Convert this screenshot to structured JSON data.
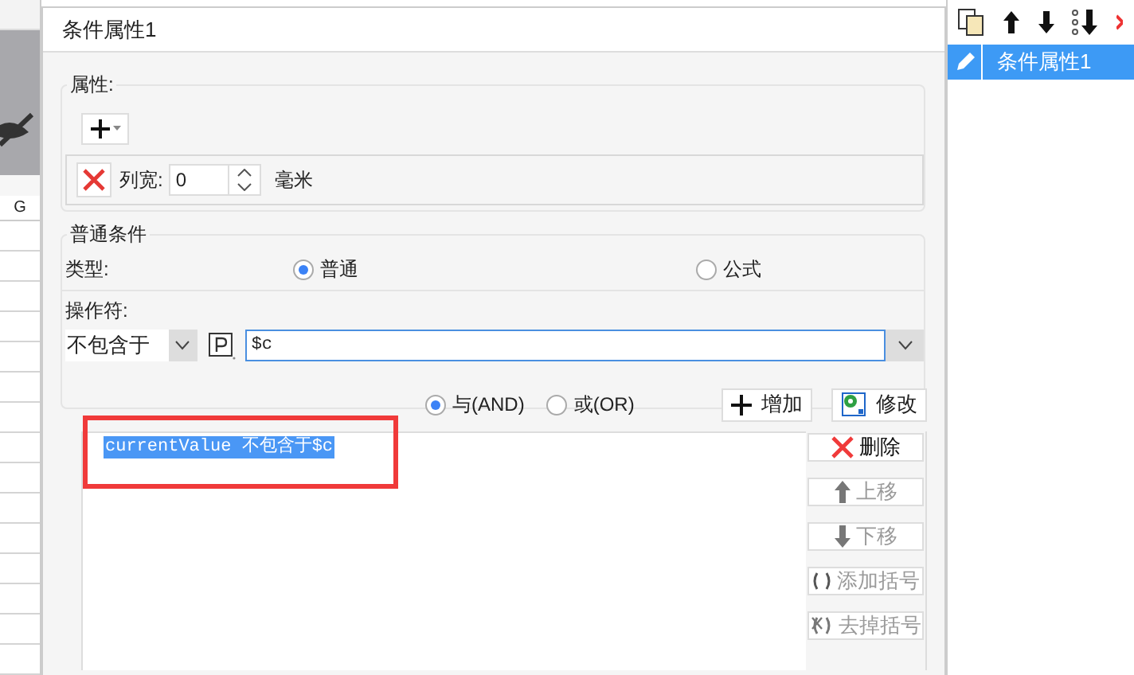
{
  "sheet": {
    "column_header": "G"
  },
  "dialog": {
    "title": "条件属性1"
  },
  "properties": {
    "legend": "属性:",
    "rows": [
      {
        "label": "列宽:",
        "value": "0",
        "unit": "毫米"
      }
    ]
  },
  "condition": {
    "legend": "普通条件",
    "type_label": "类型:",
    "types": [
      {
        "label": "普通",
        "selected": true
      },
      {
        "label": "公式",
        "selected": false
      }
    ],
    "operator_label": "操作符:",
    "operator": "不包含于",
    "operand": "$c",
    "joins": [
      {
        "label": "与(AND)",
        "selected": true
      },
      {
        "label": "或(OR)",
        "selected": false
      }
    ],
    "actions": [
      {
        "label": "增加",
        "kind": "add"
      },
      {
        "label": "修改",
        "kind": "edit"
      }
    ],
    "items": [
      {
        "text": "currentValue 不包含于$c",
        "selected": true
      }
    ],
    "side_buttons": [
      {
        "label": "删除",
        "kind": "delete",
        "disabled": false
      },
      {
        "label": "上移",
        "kind": "up",
        "disabled": true
      },
      {
        "label": "下移",
        "kind": "down",
        "disabled": true
      },
      {
        "label": "添加括号",
        "kind": "add-brackets",
        "disabled": true
      },
      {
        "label": "去掉括号",
        "kind": "remove-brackets",
        "disabled": true
      }
    ]
  },
  "condition_list": {
    "items": [
      {
        "label": "条件属性1",
        "selected": true
      }
    ]
  }
}
